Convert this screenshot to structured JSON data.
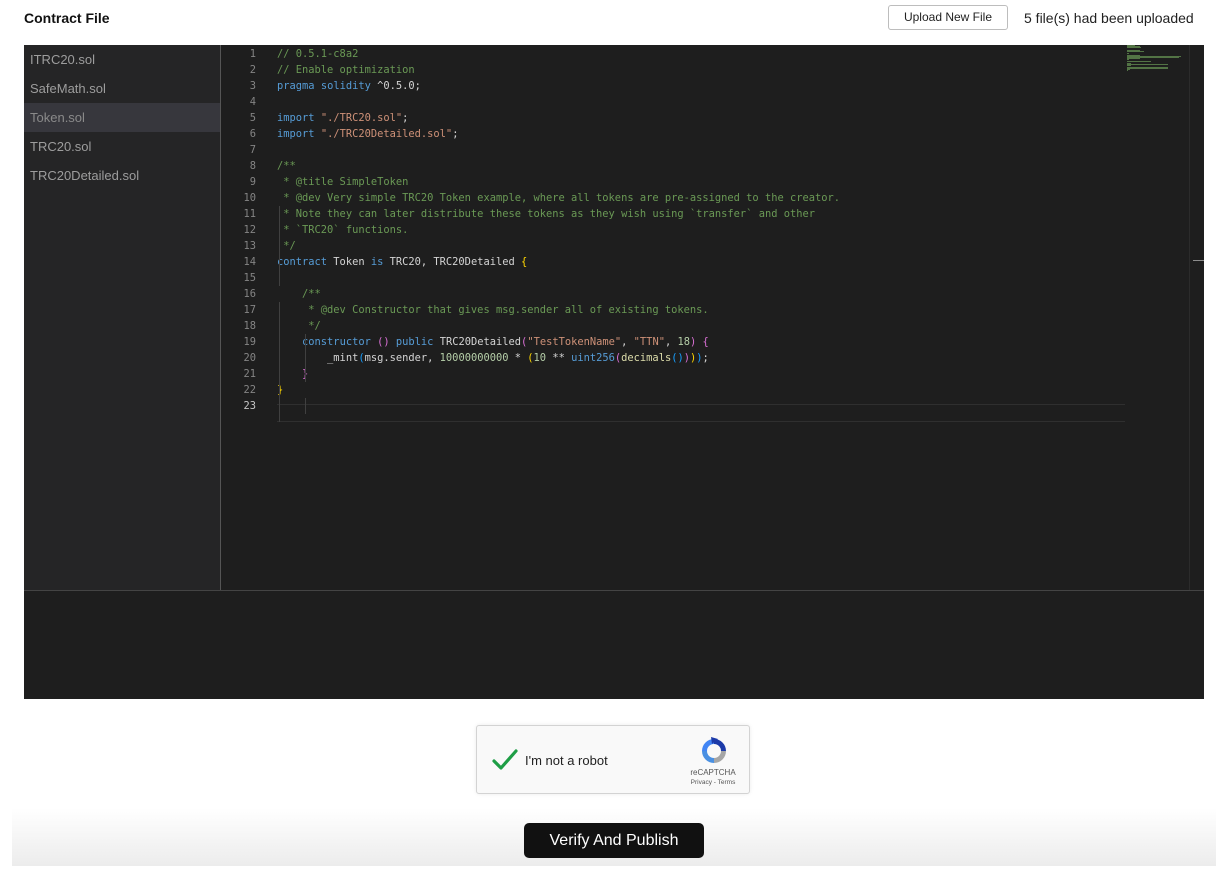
{
  "header": {
    "title": "Contract File",
    "upload_button_label": "Upload New File",
    "upload_status": "5 file(s) had been uploaded"
  },
  "files": [
    {
      "label": "ITRC20.sol",
      "active": false
    },
    {
      "label": "SafeMath.sol",
      "active": false
    },
    {
      "label": "Token.sol",
      "active": true
    },
    {
      "label": "TRC20.sol",
      "active": false
    },
    {
      "label": "TRC20Detailed.sol",
      "active": false
    }
  ],
  "editor": {
    "current_line": 23,
    "lines": [
      [
        [
          "c-com",
          "// 0.5.1-c8a2"
        ]
      ],
      [
        [
          "c-com",
          "// Enable optimization"
        ]
      ],
      [
        [
          "c-kw",
          "pragma"
        ],
        [
          "c-plain",
          " "
        ],
        [
          "c-kw",
          "solidity"
        ],
        [
          "c-plain",
          " ^0.5.0;"
        ]
      ],
      [],
      [
        [
          "c-kw",
          "import"
        ],
        [
          "c-plain",
          " "
        ],
        [
          "c-str",
          "\"./TRC20.sol\""
        ],
        [
          "c-plain",
          ";"
        ]
      ],
      [
        [
          "c-kw",
          "import"
        ],
        [
          "c-plain",
          " "
        ],
        [
          "c-str",
          "\"./TRC20Detailed.sol\""
        ],
        [
          "c-plain",
          ";"
        ]
      ],
      [],
      [
        [
          "c-com",
          "/**"
        ]
      ],
      [
        [
          "c-com",
          " * @title SimpleToken"
        ]
      ],
      [
        [
          "c-com",
          " * @dev Very simple TRC20 Token example, where all tokens are pre-assigned to the creator."
        ]
      ],
      [
        [
          "c-com",
          " * Note they can later distribute these tokens as they wish using `transfer` and other"
        ]
      ],
      [
        [
          "c-com",
          " * `TRC20` functions."
        ]
      ],
      [
        [
          "c-com",
          " */"
        ]
      ],
      [
        [
          "c-kw",
          "contract"
        ],
        [
          "c-plain",
          " Token "
        ],
        [
          "c-kw",
          "is"
        ],
        [
          "c-plain",
          " TRC20, TRC20Detailed "
        ],
        [
          "c-br1",
          "{"
        ]
      ],
      [],
      [
        [
          "c-com",
          "    /**"
        ]
      ],
      [
        [
          "c-com",
          "     * @dev Constructor that gives msg.sender all of existing tokens."
        ]
      ],
      [
        [
          "c-com",
          "     */"
        ]
      ],
      [
        [
          "c-plain",
          "    "
        ],
        [
          "c-kw",
          "constructor"
        ],
        [
          "c-plain",
          " "
        ],
        [
          "c-br2",
          "()"
        ],
        [
          "c-plain",
          " "
        ],
        [
          "c-kw",
          "public"
        ],
        [
          "c-plain",
          " TRC20Detailed"
        ],
        [
          "c-br2",
          "("
        ],
        [
          "c-str",
          "\"TestTokenName\""
        ],
        [
          "c-plain",
          ", "
        ],
        [
          "c-str",
          "\"TTN\""
        ],
        [
          "c-plain",
          ", "
        ],
        [
          "c-num",
          "18"
        ],
        [
          "c-br2",
          ")"
        ],
        [
          "c-plain",
          " "
        ],
        [
          "c-br2",
          "{"
        ]
      ],
      [
        [
          "c-plain",
          "        _mint"
        ],
        [
          "c-br3",
          "("
        ],
        [
          "c-plain",
          "msg.sender, "
        ],
        [
          "c-num",
          "10000000000"
        ],
        [
          "c-plain",
          " * "
        ],
        [
          "c-br1",
          "("
        ],
        [
          "c-num",
          "10"
        ],
        [
          "c-plain",
          " ** "
        ],
        [
          "c-kw",
          "uint256"
        ],
        [
          "c-br2",
          "("
        ],
        [
          "c-fn",
          "decimals"
        ],
        [
          "c-br3",
          "()"
        ],
        [
          "c-br2",
          ")"
        ],
        [
          "c-br1",
          ")"
        ],
        [
          "c-br3",
          ")"
        ],
        [
          "c-plain",
          ";"
        ]
      ],
      [
        [
          "c-plain",
          "    "
        ],
        [
          "c-br2",
          "}"
        ]
      ],
      [
        [
          "c-br1",
          "}"
        ]
      ],
      []
    ]
  },
  "recaptcha": {
    "label": "I'm not a robot",
    "brand": "reCAPTCHA",
    "links": "Privacy - Terms",
    "check_color": "#1e9e46"
  },
  "actions": {
    "verify_label": "Verify And Publish"
  }
}
